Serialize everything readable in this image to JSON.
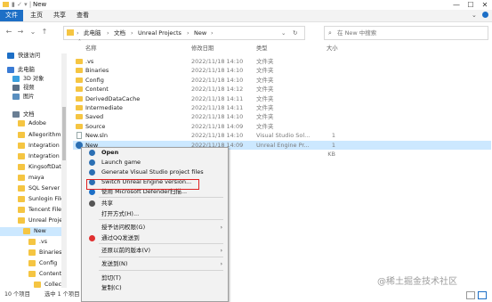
{
  "window": {
    "title": "New",
    "min": "—",
    "max": "☐",
    "close": "✕"
  },
  "ribbon": {
    "tabs": [
      "文件",
      "主页",
      "共享",
      "查看"
    ]
  },
  "address": {
    "segments": [
      "此电脑",
      "文档",
      "Unreal Projects",
      "New"
    ],
    "separator": "›"
  },
  "search": {
    "placeholder": "在 New 中搜索"
  },
  "nav": {
    "items": [
      {
        "label": "快速访问",
        "color": "#1d6fc6"
      },
      {
        "label": "此电脑",
        "color": "#3a7bd5"
      },
      {
        "label": "3D 对象",
        "color": "#3aa0e0"
      },
      {
        "label": "视频",
        "color": "#5a6f86"
      },
      {
        "label": "图片",
        "color": "#5a8fc0"
      },
      {
        "label": "文档",
        "color": "#6a7f94"
      },
      {
        "label": "Adobe",
        "color": "#f5c542"
      },
      {
        "label": "Allegorithmic",
        "color": "#f5c542"
      },
      {
        "label": "Integration Se",
        "color": "#f5c542"
      },
      {
        "label": "Integration Se",
        "color": "#f5c542"
      },
      {
        "label": "KingsoftData",
        "color": "#f5c542"
      },
      {
        "label": "maya",
        "color": "#f5c542"
      },
      {
        "label": "SQL Server M",
        "color": "#f5c542"
      },
      {
        "label": "Sunlogin Files",
        "color": "#f5c542"
      },
      {
        "label": "Tencent Files",
        "color": "#f5c542"
      },
      {
        "label": "Unreal Projec",
        "color": "#f5c542"
      },
      {
        "label": "New",
        "color": "#f5c542"
      },
      {
        "label": ".vs",
        "color": "#f5c542"
      },
      {
        "label": "Binaries",
        "color": "#f5c542"
      },
      {
        "label": "Config",
        "color": "#f5c542"
      },
      {
        "label": "Content",
        "color": "#f5c542"
      },
      {
        "label": "Collection",
        "color": "#f5c542"
      }
    ]
  },
  "columns": {
    "name": "名称",
    "date": "修改日期",
    "type": "类型",
    "size": "大小"
  },
  "files": [
    {
      "name": ".vs",
      "date": "2022/11/18 14:10",
      "type": "文件夹",
      "size": "",
      "kind": "folder"
    },
    {
      "name": "Binaries",
      "date": "2022/11/18 14:10",
      "type": "文件夹",
      "size": "",
      "kind": "folder"
    },
    {
      "name": "Config",
      "date": "2022/11/18 14:10",
      "type": "文件夹",
      "size": "",
      "kind": "folder"
    },
    {
      "name": "Content",
      "date": "2022/11/18 14:12",
      "type": "文件夹",
      "size": "",
      "kind": "folder"
    },
    {
      "name": "DerivedDataCache",
      "date": "2022/11/18 14:11",
      "type": "文件夹",
      "size": "",
      "kind": "folder"
    },
    {
      "name": "Intermediate",
      "date": "2022/11/18 14:11",
      "type": "文件夹",
      "size": "",
      "kind": "folder"
    },
    {
      "name": "Saved",
      "date": "2022/11/18 14:10",
      "type": "文件夹",
      "size": "",
      "kind": "folder"
    },
    {
      "name": "Source",
      "date": "2022/11/18 14:09",
      "type": "文件夹",
      "size": "",
      "kind": "folder"
    },
    {
      "name": "New.sln",
      "date": "2022/11/18 14:10",
      "type": "Visual Studio Sol...",
      "size": "1 KB",
      "kind": "file"
    },
    {
      "name": "New",
      "date": "2022/11/18 14:09",
      "type": "Unreal Engine Pr...",
      "size": "1 KB",
      "kind": "ue"
    }
  ],
  "status": {
    "count": "10 个项目",
    "selected": "选中 1 个项目 329"
  },
  "context_menu": {
    "items": [
      {
        "label": "Open",
        "bold": true,
        "icon": "ue"
      },
      {
        "label": "Launch game",
        "icon": "ue"
      },
      {
        "label": "Generate Visual Studio project files",
        "icon": "ue"
      },
      {
        "label": "Switch Unreal Engine version...",
        "icon": "ue"
      },
      {
        "label": "使用 Microsoft Defender扫描...",
        "icon": "defender"
      },
      {
        "label": "共享",
        "icon": "share"
      },
      {
        "label": "打开方式(H)...",
        "icon": ""
      },
      {
        "label": "授予访问权限(G)",
        "icon": "",
        "sub": true
      },
      {
        "label": "通过QQ发送到",
        "icon": "qq"
      },
      {
        "label": "还原以前的版本(V)",
        "icon": "",
        "sub": true
      },
      {
        "label": "发送到(N)",
        "icon": "",
        "sub": true
      },
      {
        "label": "剪切(T)",
        "icon": ""
      },
      {
        "label": "复制(C)",
        "icon": ""
      }
    ]
  },
  "watermark": "@稀土掘金技术社区",
  "colors": {
    "accent": "#1d6fc6",
    "selection": "#cce8ff",
    "highlight": "#e02020"
  }
}
